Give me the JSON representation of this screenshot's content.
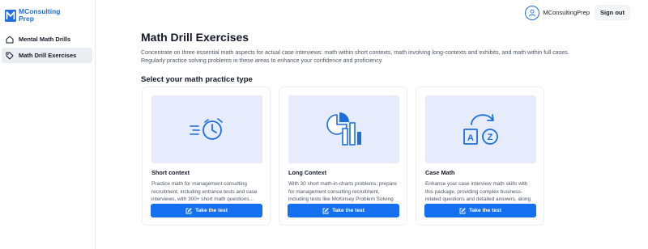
{
  "brand": {
    "line1": "MConsulting",
    "line2": "Prep",
    "color": "#1d6fe0"
  },
  "sidebar": {
    "items": [
      {
        "label": "Mental Math Drills",
        "icon": "home-icon",
        "active": false
      },
      {
        "label": "Math Drill Exercises",
        "icon": "tag-icon",
        "active": true
      }
    ]
  },
  "header": {
    "user_name": "MConsultingPrep",
    "signout_label": "Sign out"
  },
  "main": {
    "title": "Math Drill Exercises",
    "description": "Concentrate on three essential math aspects for actual case interviews: math within short contexts, math involving long-contexts and exhibits, and math within full cases. Regularly practice solving problems in these areas to enhance your confidence and proficiency.",
    "section_title": "Select your math practice type",
    "cards": [
      {
        "title": "Short context",
        "description": "Practice math for management consulting recruitment, including entrance tests and case interviews, with 300+ short math questions...",
        "button": "Take the test",
        "icon": "fast-timer-icon"
      },
      {
        "title": "Long Context",
        "description": "With 30 short math-in-charts problems, prepare for management consulting recruitment, including tests like McKinsey Problem Solving Game and...",
        "button": "Take the test",
        "icon": "pie-bar-chart-icon"
      },
      {
        "title": "Case Math",
        "description": "Enhance your case interview math skills with this package, providing complex business-related questions and detailed answers, along with...",
        "button": "Take the test",
        "icon": "a-to-z-cycle-icon"
      }
    ]
  },
  "colors": {
    "accent": "#1570ef",
    "card_image_bg": "#e6ecfb",
    "active_nav_bg": "#ebedf0"
  }
}
